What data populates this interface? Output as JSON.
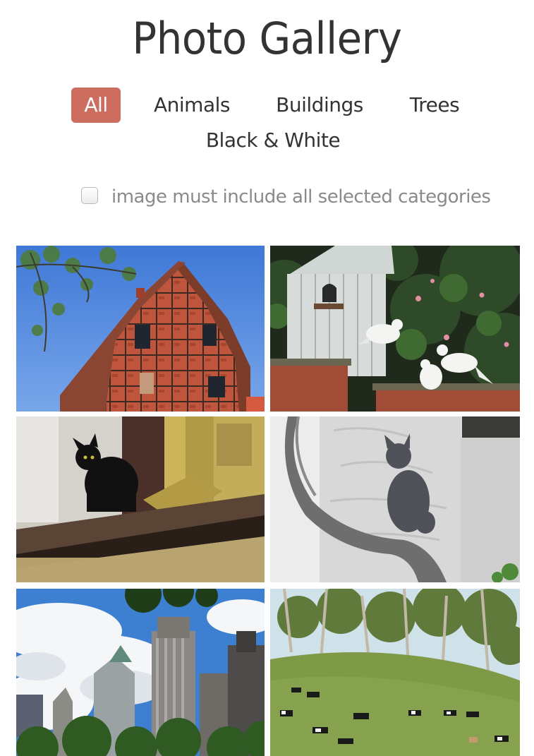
{
  "gallery": {
    "title": "Photo Gallery",
    "filters": [
      {
        "label": "All",
        "active": true
      },
      {
        "label": "Animals",
        "active": false
      },
      {
        "label": "Buildings",
        "active": false
      },
      {
        "label": "Trees",
        "active": false
      },
      {
        "label": "Black & White",
        "active": false
      }
    ],
    "match_all_label": "image must include all selected categories",
    "match_all_checked": false,
    "photo_count": 6
  },
  "colors": {
    "accent": "#cd6d5f",
    "text": "#333333",
    "muted": "#8a8a8a"
  }
}
